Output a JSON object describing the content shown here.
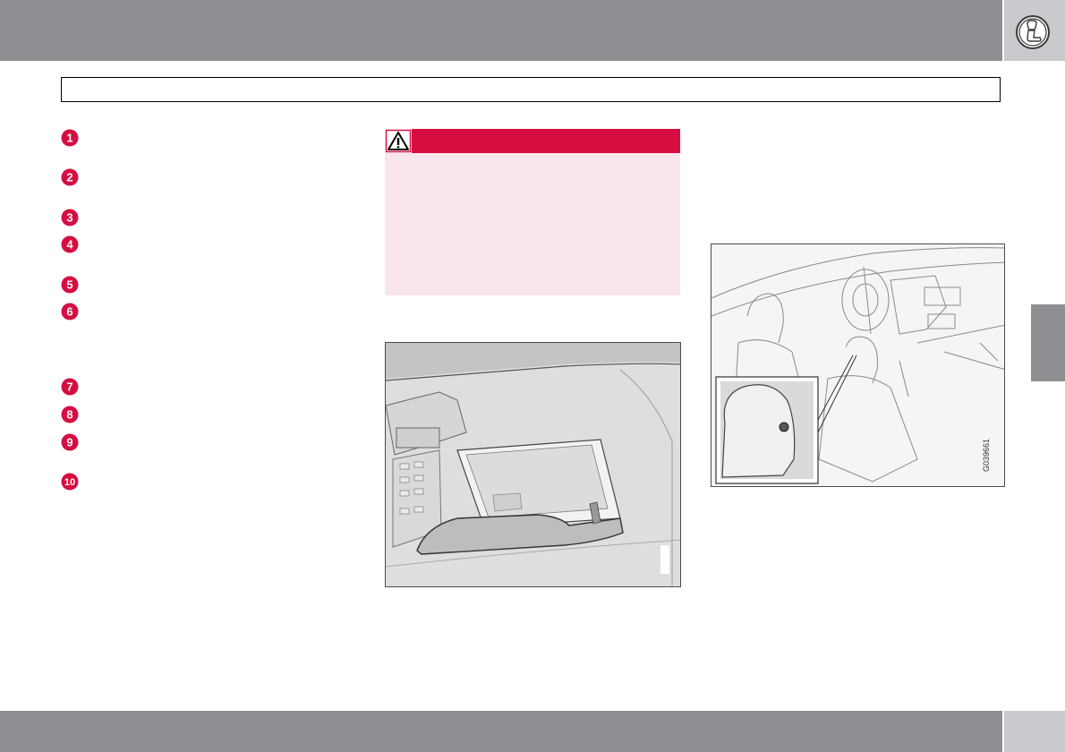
{
  "header": {
    "seat_icon": "seat-headrest-icon"
  },
  "numbered_items": [
    {
      "number": "1"
    },
    {
      "number": "2"
    },
    {
      "number": "3"
    },
    {
      "number": "4"
    },
    {
      "number": "5"
    },
    {
      "number": "6"
    },
    {
      "number": "7"
    },
    {
      "number": "8"
    },
    {
      "number": "9"
    },
    {
      "number": "10"
    }
  ],
  "warning": {
    "icon": "warning-triangle-icon"
  },
  "figures": {
    "glovebox": {
      "icon": "glovebox-illustration"
    },
    "headrest": {
      "icon": "headrest-illustration",
      "code": "G039661"
    }
  },
  "colors": {
    "header_gray": "#8e8f93",
    "tab_light_gray": "#c9cacd",
    "marker_red": "#d50d40",
    "warning_background": "#fbe5ec"
  }
}
